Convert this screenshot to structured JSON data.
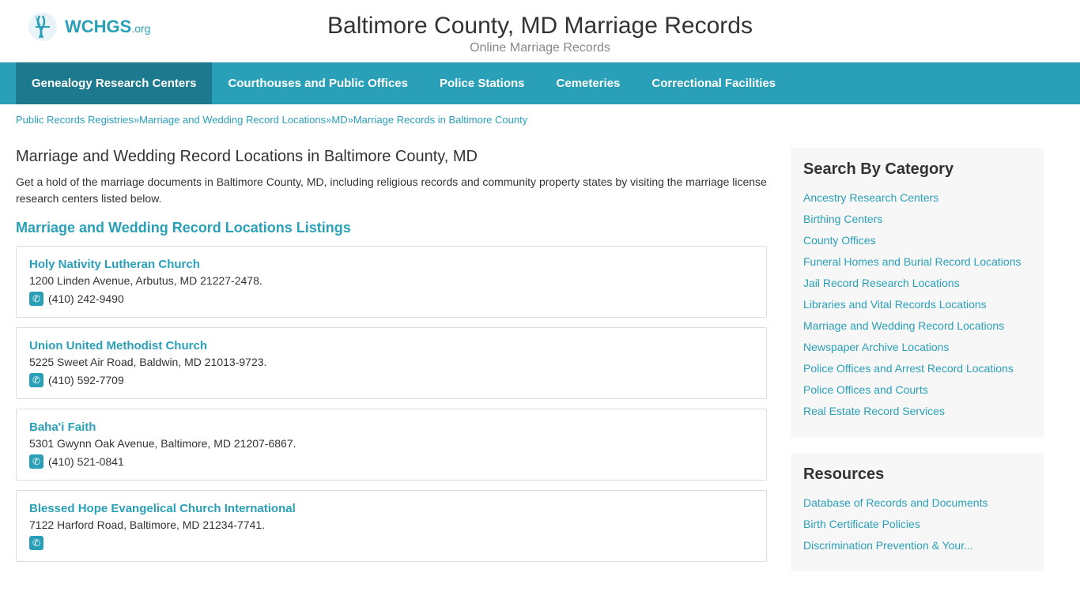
{
  "header": {
    "logo_text": "WCHGS",
    "logo_suffix": ".org",
    "site_title": "Baltimore County, MD Marriage Records",
    "site_subtitle": "Online Marriage Records"
  },
  "nav": {
    "items": [
      {
        "label": "Genealogy Research Centers",
        "active": false
      },
      {
        "label": "Courthouses and Public Offices",
        "active": false
      },
      {
        "label": "Police Stations",
        "active": false
      },
      {
        "label": "Cemeteries",
        "active": false
      },
      {
        "label": "Correctional Facilities",
        "active": false
      }
    ]
  },
  "breadcrumb": {
    "links": [
      {
        "text": "Public Records Registries",
        "href": "#"
      },
      {
        "text": "Marriage and Wedding Record Locations",
        "href": "#"
      },
      {
        "text": "MD",
        "href": "#"
      },
      {
        "text": "Marriage Records in Baltimore County",
        "href": "#"
      }
    ]
  },
  "content": {
    "page_heading": "Marriage and Wedding Record Locations in Baltimore County, MD",
    "page_description": "Get a hold of the marriage documents in Baltimore County, MD, including religious records and community property states by visiting the marriage license research centers listed below.",
    "listings_heading": "Marriage and Wedding Record Locations Listings",
    "locations": [
      {
        "name": "Holy Nativity Lutheran Church",
        "address": "1200 Linden Avenue, Arbutus, MD 21227-2478.",
        "phone": "(410) 242-9490"
      },
      {
        "name": "Union United Methodist Church",
        "address": "5225 Sweet Air Road, Baldwin, MD 21013-9723.",
        "phone": "(410) 592-7709"
      },
      {
        "name": "Baha'i Faith",
        "address": "5301 Gwynn Oak Avenue, Baltimore, MD 21207-6867.",
        "phone": "(410) 521-0841"
      },
      {
        "name": "Blessed Hope Evangelical Church International",
        "address": "7122 Harford Road, Baltimore, MD 21234-7741.",
        "phone": ""
      }
    ]
  },
  "sidebar": {
    "search_title": "Search By Category",
    "category_links": [
      "Ancestry Research Centers",
      "Birthing Centers",
      "County Offices",
      "Funeral Homes and Burial Record Locations",
      "Jail Record Research Locations",
      "Libraries and Vital Records Locations",
      "Marriage and Wedding Record Locations",
      "Newspaper Archive Locations",
      "Police Offices and Arrest Record Locations",
      "Police Offices and Courts",
      "Real Estate Record Services"
    ],
    "resources_title": "Resources",
    "resource_links": [
      "Database of Records and Documents",
      "Birth Certificate Policies",
      "Discrimination Prevention & Your..."
    ]
  }
}
